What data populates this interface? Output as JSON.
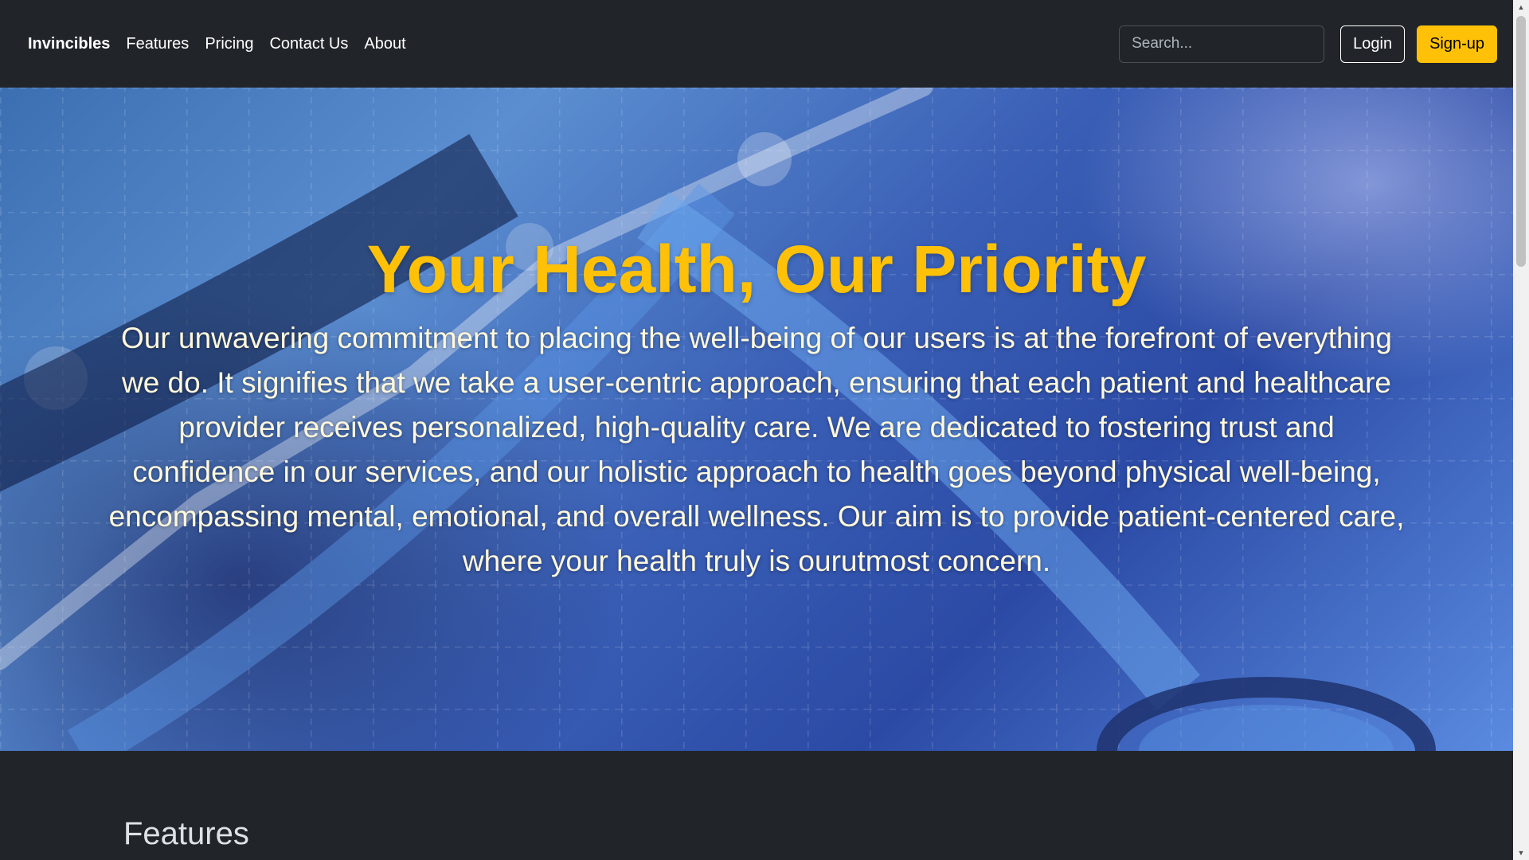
{
  "navbar": {
    "brand": "Invincibles",
    "links": [
      "Features",
      "Pricing",
      "Contact Us",
      "About"
    ],
    "search": {
      "placeholder": "Search...",
      "value": ""
    },
    "login_label": "Login",
    "signup_label": "Sign-up"
  },
  "hero": {
    "title": "Your Health, Our Priority",
    "text": "Our unwavering commitment to placing the well-being of our users is at the forefront of everything we do. It signifies that we take a user-centric approach, ensuring that each patient and healthcare provider receives personalized, high-quality care. We are dedicated to fostering trust and confidence in our services, and our holistic approach to health goes beyond physical well-being, encompassing mental, emotional, and overall wellness. Our aim is to provide patient-centered care, where your health truly is ourutmost concern."
  },
  "features": {
    "heading": "Features"
  },
  "colors": {
    "background": "#212529",
    "accent": "#ffc107",
    "text": "#ffffff"
  },
  "icons": {
    "scroll_up": "scroll-up-arrow-icon",
    "scroll_down": "scroll-down-arrow-icon"
  }
}
